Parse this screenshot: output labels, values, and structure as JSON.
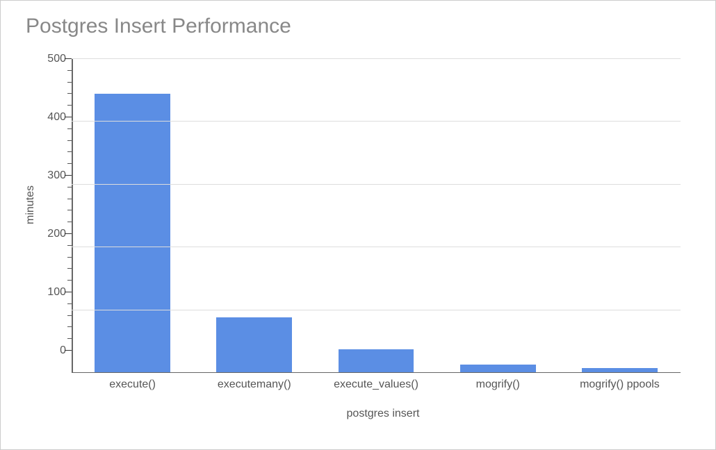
{
  "chart_data": {
    "type": "bar",
    "title": "Postgres Insert Performance",
    "xlabel": "postgres insert",
    "ylabel": "minutes",
    "categories": [
      "execute()",
      "executemany()",
      "execute_values()",
      "mogrify()",
      "mogrify() ppools"
    ],
    "values": [
      445,
      88,
      38,
      13,
      8
    ],
    "ylim": [
      0,
      500
    ],
    "y_ticks": [
      0,
      100,
      200,
      300,
      400,
      500
    ],
    "bar_color": "#5b8ee4"
  }
}
